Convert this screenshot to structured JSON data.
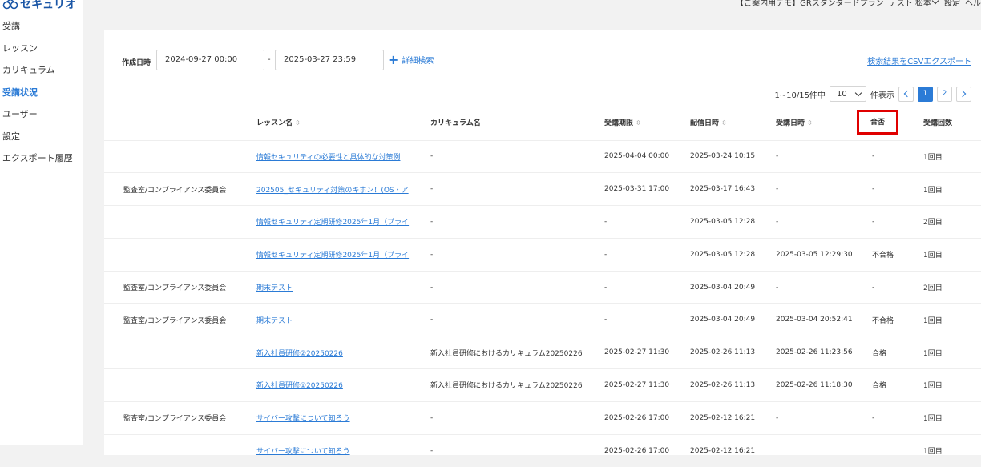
{
  "app": {
    "logo_text": "セキュリオ"
  },
  "sidebar": {
    "items": [
      {
        "label": "受講",
        "active": false
      },
      {
        "label": "レッスン",
        "active": false
      },
      {
        "label": "カリキュラム",
        "active": false
      },
      {
        "label": "受講状況",
        "active": true
      },
      {
        "label": "ユーザー",
        "active": false
      },
      {
        "label": "設定",
        "active": false
      },
      {
        "label": "エクスポート履歴",
        "active": false
      }
    ]
  },
  "topbar": {
    "plan": "【ご案内用デモ】GRスタンダードプラン",
    "user": "テスト 松本",
    "settings": "設定",
    "help": "ヘル"
  },
  "filter": {
    "created_label": "作成日時",
    "date_start": "2024-09-27 00:00",
    "date_separator": "-",
    "date_end": "2025-03-27 23:59",
    "advanced_search": "詳細検索",
    "csv_export": "検索結果をCSVエクスポート"
  },
  "pagination": {
    "range": "1~10/15件中",
    "per_page": "10",
    "per_page_suffix": "件表示",
    "pages": [
      "1",
      "2"
    ]
  },
  "table": {
    "headers": {
      "lesson": "レッスン名",
      "curriculum": "カリキュラム名",
      "deadline": "受講期限",
      "delivered": "配信日時",
      "taken": "受講日時",
      "result": "合否",
      "count": "受講回数"
    },
    "rows": [
      {
        "group": "",
        "lesson": "情報セキュリティの必要性と具体的な対策例",
        "curriculum": "-",
        "deadline": "2025-04-04 00:00",
        "delivered": "2025-03-24 10:15",
        "taken": "-",
        "result": "-",
        "count": "1回目"
      },
      {
        "group": "監査室/コンプライアンス委員会",
        "lesson": "202505_セキュリティ対策のキホン！(OS・ア",
        "curriculum": "-",
        "deadline": "2025-03-31 17:00",
        "delivered": "2025-03-17 16:43",
        "taken": "-",
        "result": "-",
        "count": "1回目"
      },
      {
        "group": "",
        "lesson": "情報セキュリティ定期研修2025年1月（プライ",
        "curriculum": "-",
        "deadline": "-",
        "delivered": "2025-03-05 12:28",
        "taken": "-",
        "result": "-",
        "count": "2回目"
      },
      {
        "group": "",
        "lesson": "情報セキュリティ定期研修2025年1月（プライ",
        "curriculum": "-",
        "deadline": "-",
        "delivered": "2025-03-05 12:28",
        "taken": "2025-03-05 12:29:30",
        "result": "不合格",
        "count": "1回目"
      },
      {
        "group": "監査室/コンプライアンス委員会",
        "lesson": "期末テスト",
        "curriculum": "-",
        "deadline": "-",
        "delivered": "2025-03-04 20:49",
        "taken": "-",
        "result": "-",
        "count": "2回目"
      },
      {
        "group": "監査室/コンプライアンス委員会",
        "lesson": "期末テスト",
        "curriculum": "-",
        "deadline": "-",
        "delivered": "2025-03-04 20:49",
        "taken": "2025-03-04 20:52:41",
        "result": "不合格",
        "count": "1回目"
      },
      {
        "group": "",
        "lesson": "新入社員研修②20250226",
        "curriculum": "新入社員研修におけるカリキュラム20250226",
        "deadline": "2025-02-27 11:30",
        "delivered": "2025-02-26 11:13",
        "taken": "2025-02-26 11:23:56",
        "result": "合格",
        "count": "1回目"
      },
      {
        "group": "",
        "lesson": "新入社員研修①20250226",
        "curriculum": "新入社員研修におけるカリキュラム20250226",
        "deadline": "2025-02-27 11:30",
        "delivered": "2025-02-26 11:13",
        "taken": "2025-02-26 11:18:30",
        "result": "合格",
        "count": "1回目"
      },
      {
        "group": "監査室/コンプライアンス委員会",
        "lesson": "サイバー攻撃について知ろう",
        "curriculum": "-",
        "deadline": "2025-02-26 17:00",
        "delivered": "2025-02-12 16:21",
        "taken": "-",
        "result": "-",
        "count": "1回目"
      },
      {
        "group": "",
        "lesson": "サイバー攻撃について知ろう",
        "curriculum": "-",
        "deadline": "2025-02-26 17:00",
        "delivered": "2025-02-12 16:21",
        "taken": "",
        "result": "",
        "count": "1回目"
      }
    ]
  }
}
